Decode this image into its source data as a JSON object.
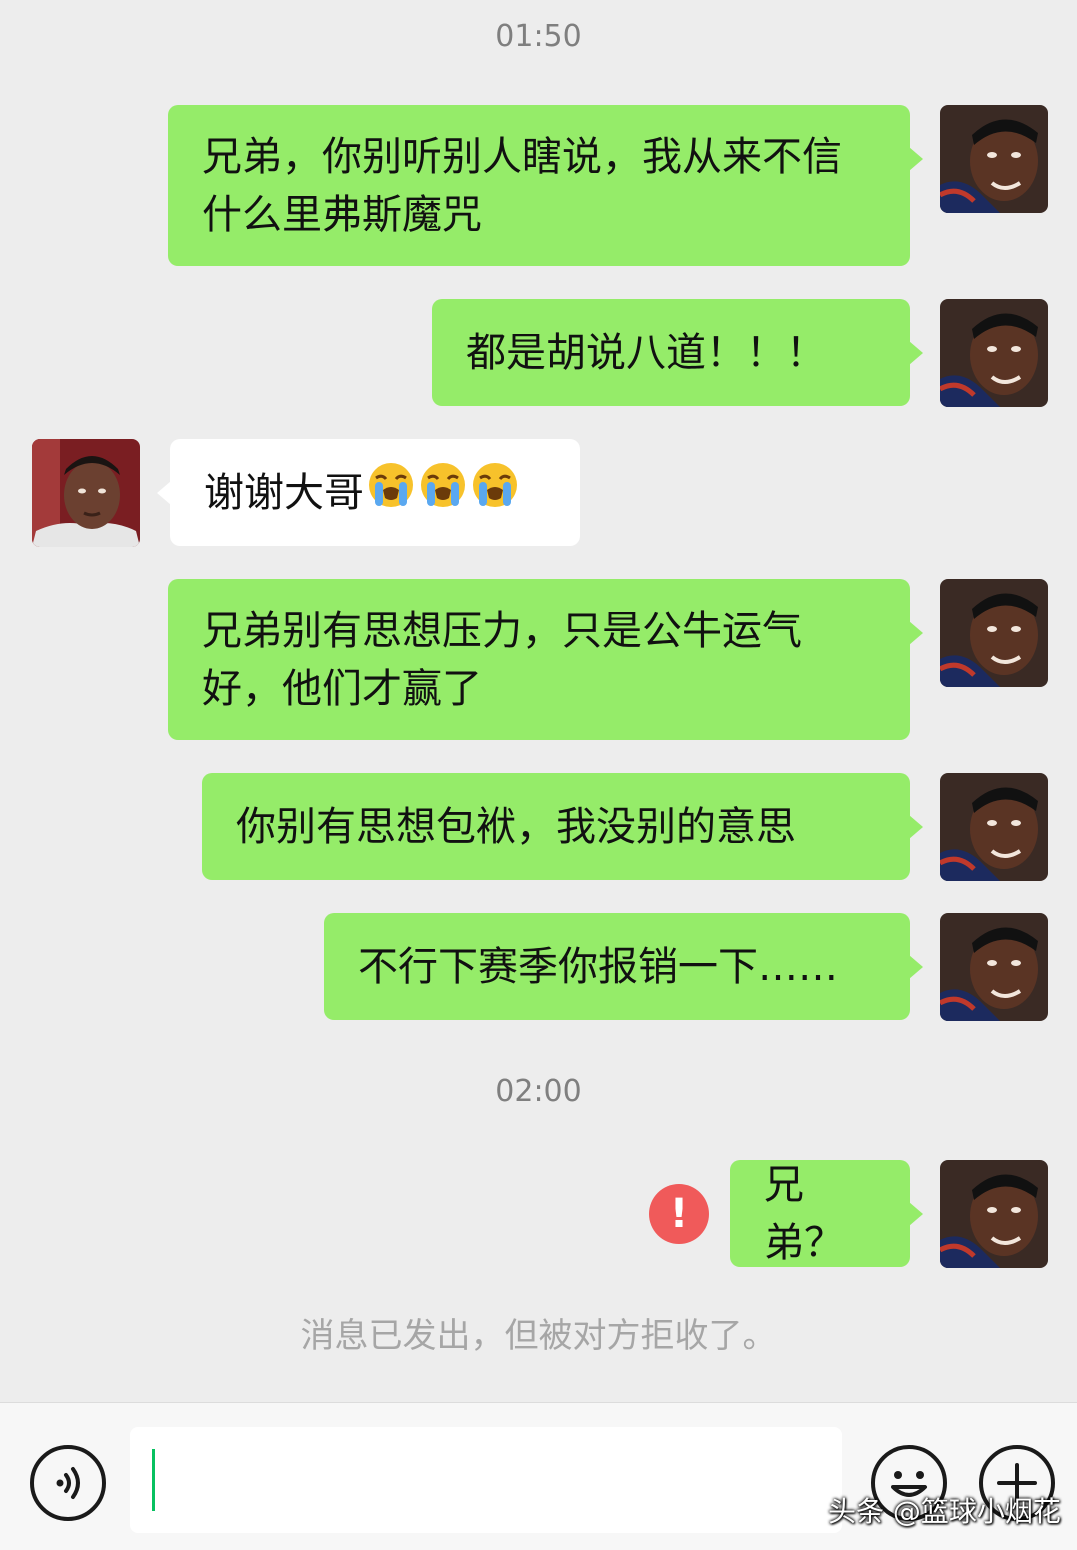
{
  "chat": {
    "timestamps": [
      "01:50",
      "02:00"
    ],
    "messages": [
      {
        "from": "me",
        "text": "兄弟，你别听别人瞎说，我从来不信什么里弗斯魔咒"
      },
      {
        "from": "me",
        "text": "都是胡说八道！！！"
      },
      {
        "from": "other",
        "text": "谢谢大哥",
        "emojis": [
          "loudly-crying-face-emoji",
          "loudly-crying-face-emoji",
          "loudly-crying-face-emoji"
        ]
      },
      {
        "from": "me",
        "text": "兄弟别有思想压力，只是公牛运气好，他们才赢了"
      },
      {
        "from": "me",
        "text": "你别有思想包袱，我没别的意思"
      },
      {
        "from": "me",
        "text": "不行下赛季你报销一下……"
      },
      {
        "from": "me",
        "text": "兄弟？",
        "status": "failed"
      }
    ],
    "system_notice": "消息已发出，但被对方拒收了。",
    "error_mark": "!"
  },
  "input_bar": {
    "voice_icon": "voice-input-icon",
    "emoji_icon": "emoji-smile-icon",
    "plus_icon": "plus-icon",
    "text_value": ""
  },
  "watermark": "头条 @篮球小烟花",
  "colors": {
    "outgoing_bubble": "#95ec69",
    "incoming_bubble": "#ffffff",
    "background": "#ededed",
    "error": "#f05a5a",
    "caret": "#07c160"
  }
}
